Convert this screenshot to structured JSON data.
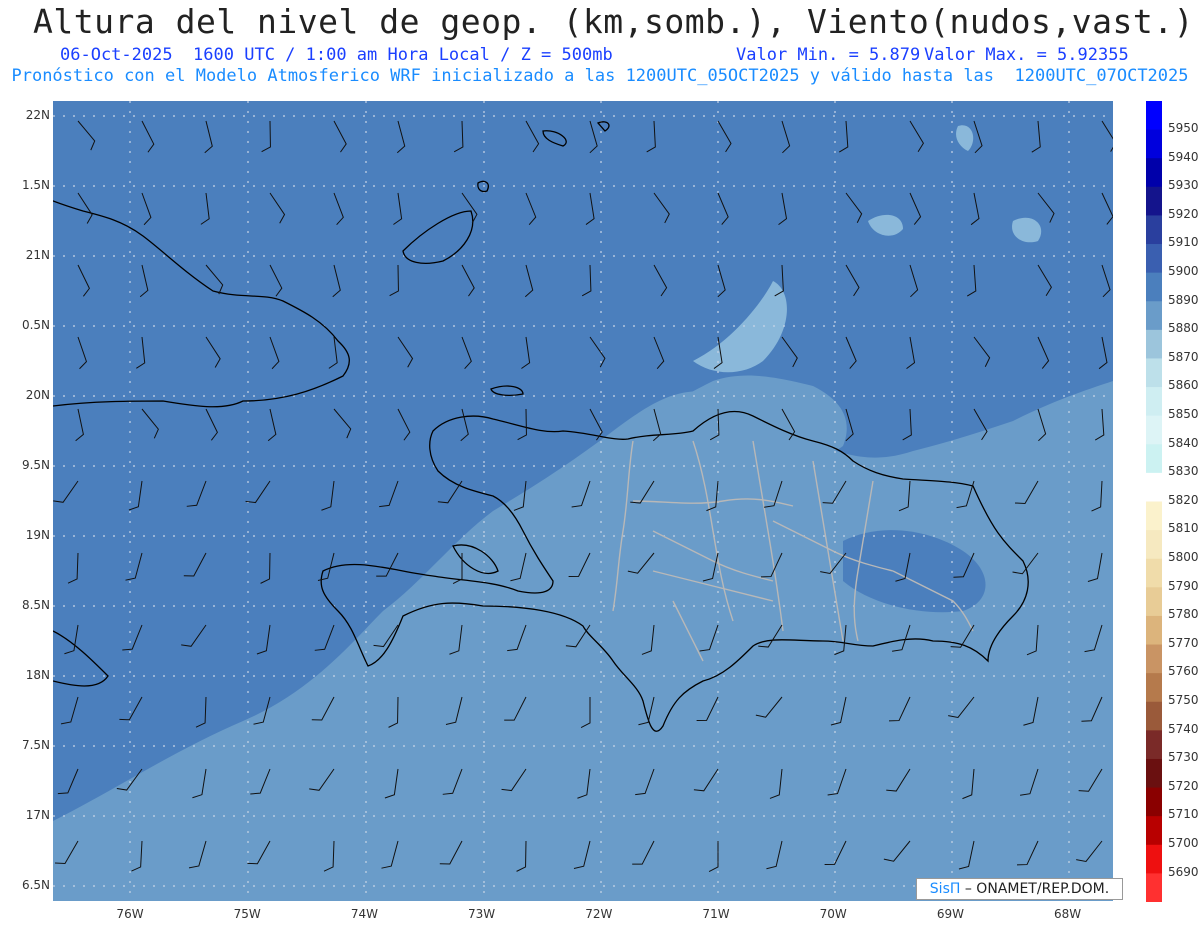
{
  "header": {
    "title": "Altura del nivel de geop. (km,somb.), Viento(nudos,vast.)",
    "date_line": "06-Oct-2025  1600 UTC / 1:00 am Hora Local / Z = 500mb",
    "min_line": "Valor Min. = 5.879",
    "max_line": "Valor Max. = 5.92355",
    "model_line": "Pronóstico con el Modelo Atmosferico WRF inicializado a las 1200UTC_05OCT2025 y válido hasta las  1200UTC_07OCT2025"
  },
  "axes": {
    "lat_labels": [
      "22N",
      "1.5N",
      "21N",
      "0.5N",
      "20N",
      "9.5N",
      "19N",
      "8.5N",
      "18N",
      "7.5N",
      "17N",
      "6.5N"
    ],
    "lon_labels": [
      "76W",
      "75W",
      "74W",
      "73W",
      "72W",
      "71W",
      "70W",
      "69W",
      "68W"
    ]
  },
  "colorbar": {
    "labels": [
      "5950",
      "5940",
      "5930",
      "5920",
      "5910",
      "5900",
      "5890",
      "5880",
      "5870",
      "5860",
      "5850",
      "5840",
      "5830",
      "5820",
      "5810",
      "5800",
      "5790",
      "5780",
      "5770",
      "5760",
      "5750",
      "5740",
      "5730",
      "5720",
      "5710",
      "5700",
      "5690"
    ],
    "colors": [
      "#0000ff",
      "#0000dd",
      "#0000aa",
      "#14148c",
      "#2a3f9e",
      "#3a5fb0",
      "#4b7fbd",
      "#6a9cc9",
      "#9cc5dc",
      "#bde0ea",
      "#cfeef2",
      "#ddf4f6",
      "#ccf2f2",
      "#ffffff",
      "#fbf2cc",
      "#f6e9c0",
      "#f0dcaa",
      "#e8cc96",
      "#dcb47c",
      "#c99464",
      "#b57a4c",
      "#9a5a3a",
      "#7a2a28",
      "#6a1010",
      "#8a0000",
      "#b80000",
      "#ee1010",
      "#ff3030"
    ]
  },
  "field_colors": {
    "level_5890": "#4b7fbd",
    "level_5880": "#6a9cc9",
    "level_5870": "#8ab8da",
    "coast": "#000000",
    "province": "#b8b8b8"
  },
  "credit": {
    "sis": "SisΠ",
    "rest": " – ONAMET/REP.DOM."
  }
}
